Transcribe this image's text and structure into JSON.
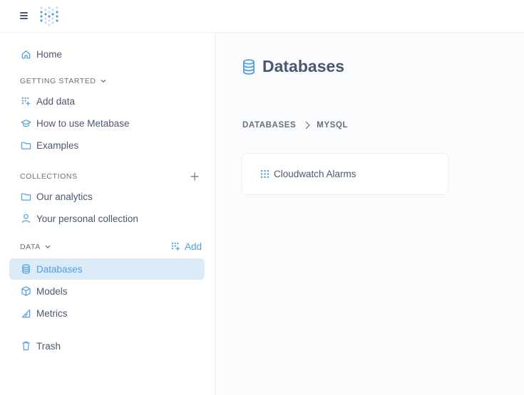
{
  "sidebar": {
    "home": "Home",
    "getting_started": "GETTING STARTED",
    "add_data": "Add data",
    "how_to_use": "How to use Metabase",
    "examples": "Examples",
    "collections": "COLLECTIONS",
    "our_analytics": "Our analytics",
    "personal_collection": "Your personal collection",
    "data": "DATA",
    "data_add": "Add",
    "databases": "Databases",
    "models": "Models",
    "metrics": "Metrics",
    "trash": "Trash"
  },
  "main": {
    "title": "Databases",
    "breadcrumb": [
      "DATABASES",
      "MYSQL"
    ],
    "tables": [
      {
        "name": "Cloudwatch Alarms"
      }
    ]
  },
  "colors": {
    "brand": "#509ee3",
    "active_bg": "#dcebf8",
    "text": "#4c5773"
  }
}
